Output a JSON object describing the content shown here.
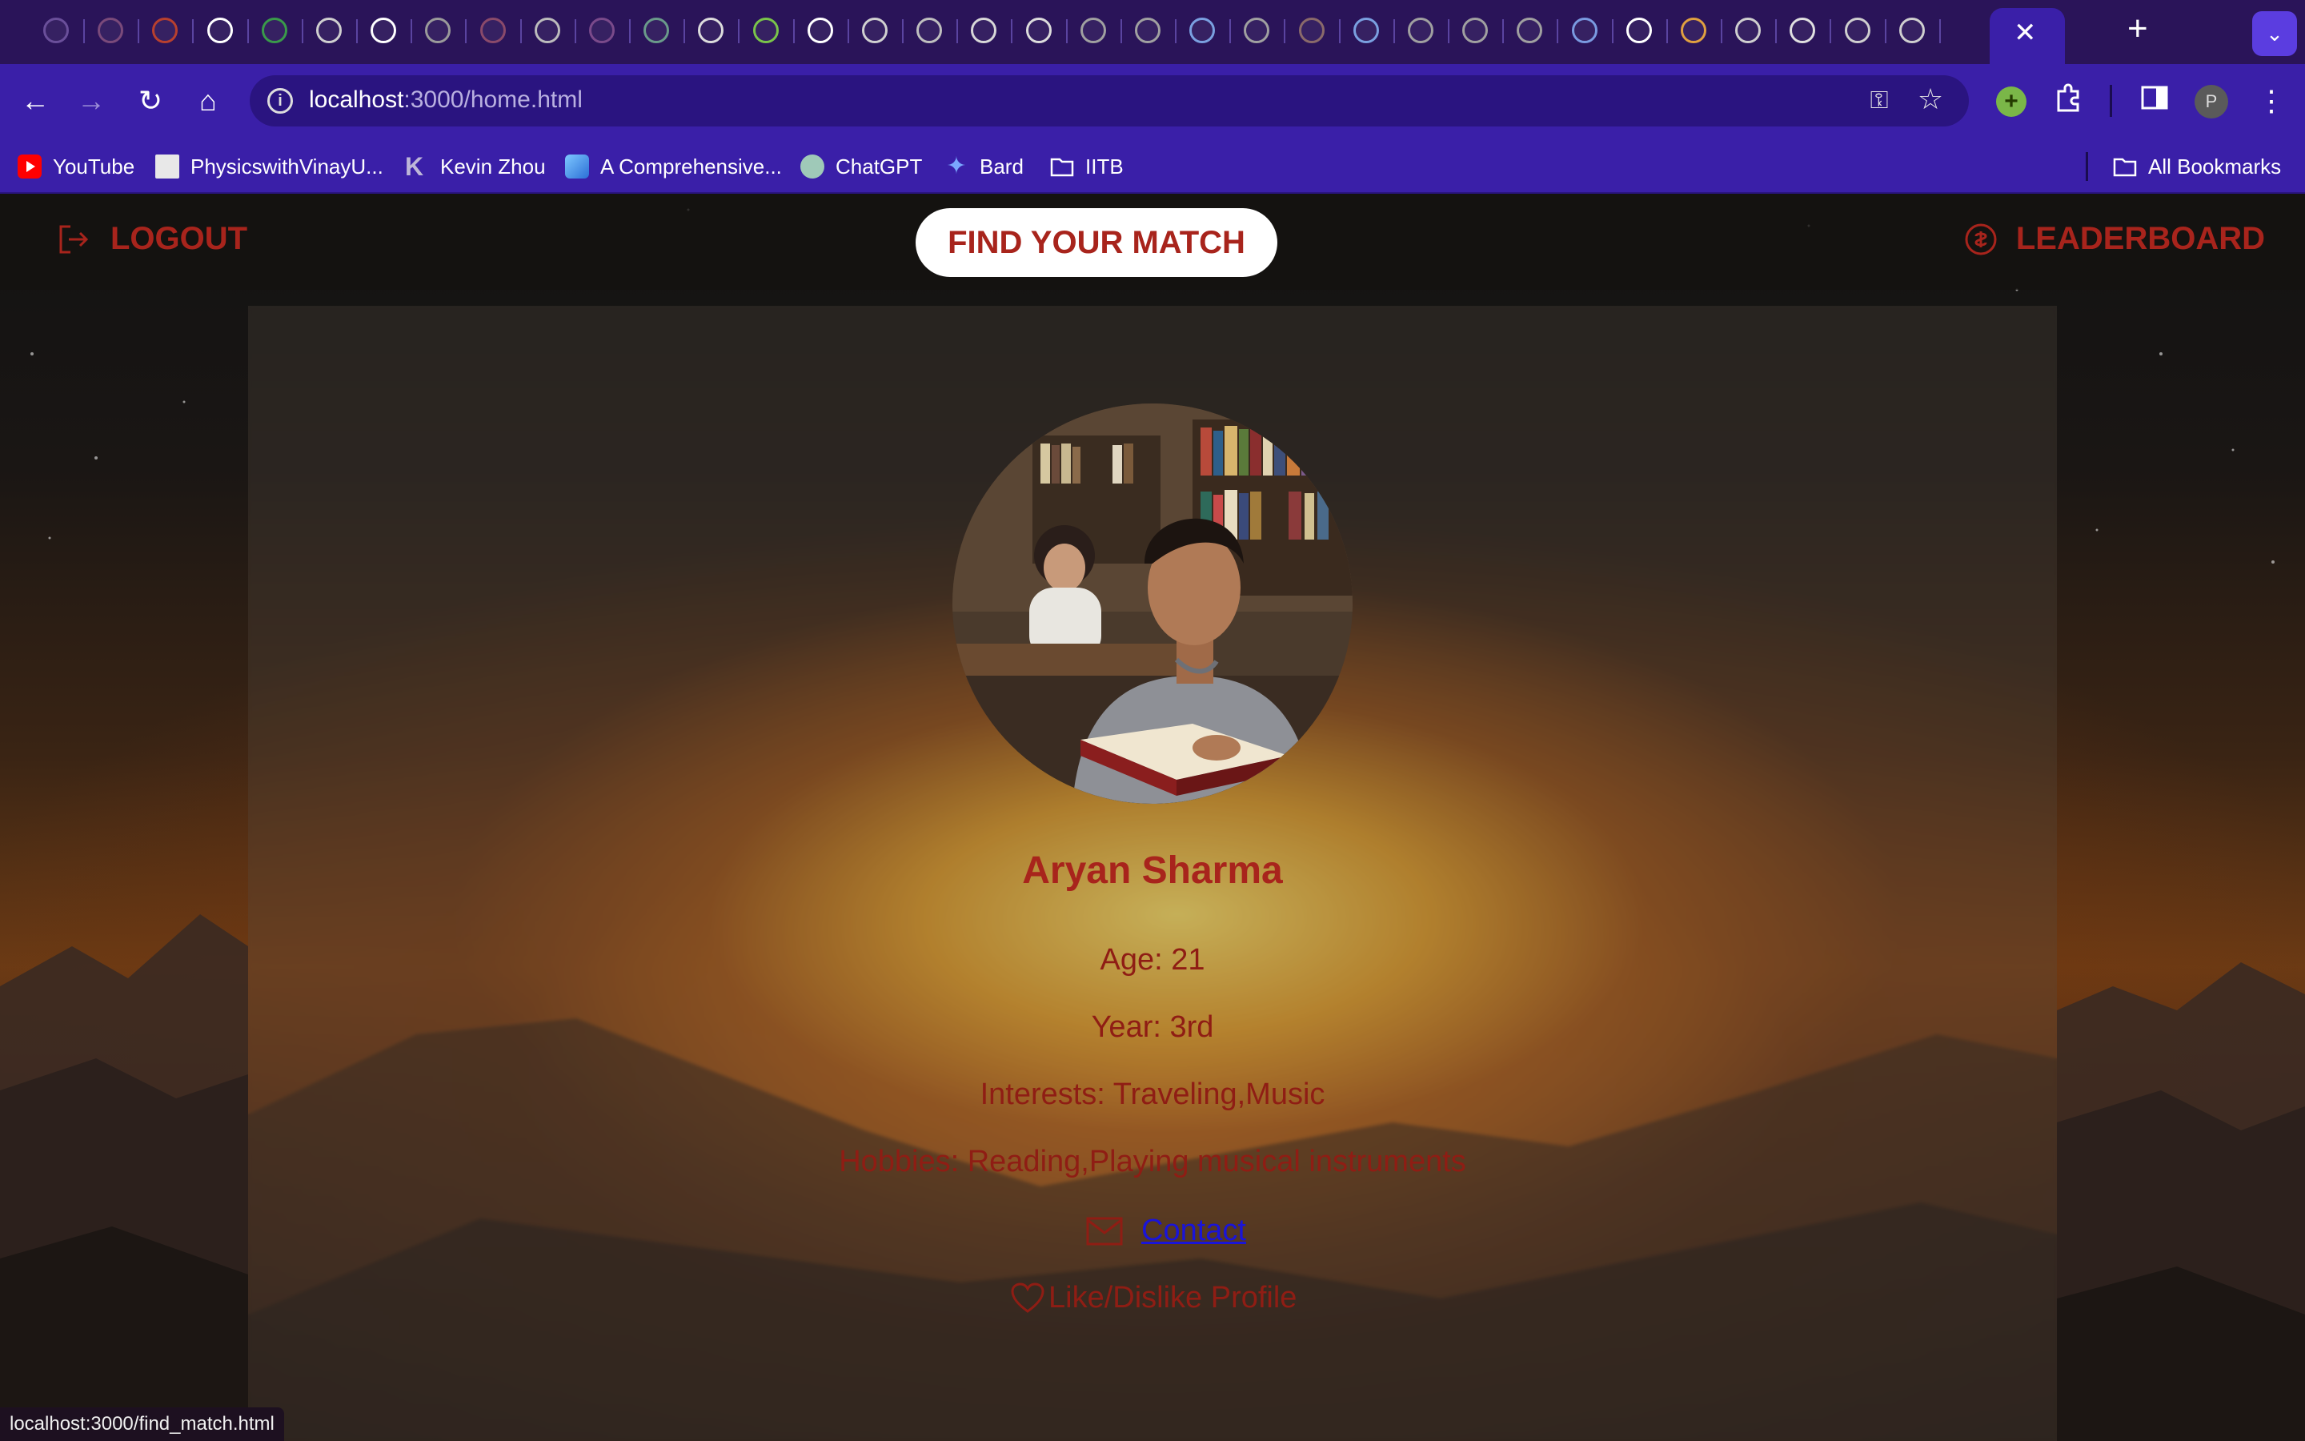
{
  "browser": {
    "tab_count_icons": 37,
    "url_host": "localhost",
    "url_path": ":3000/home.html",
    "profile_initial": "P",
    "status_url": "localhost:3000/find_match.html",
    "bookmarks": [
      {
        "label": "YouTube",
        "icon": "youtube-icon"
      },
      {
        "label": "PhysicswithVinayU...",
        "icon": "site-icon"
      },
      {
        "label": "Kevin Zhou",
        "icon": "k-icon"
      },
      {
        "label": "A Comprehensive...",
        "icon": "cube-icon"
      },
      {
        "label": "ChatGPT",
        "icon": "chatgpt-icon"
      },
      {
        "label": "Bard",
        "icon": "sparkle-icon"
      },
      {
        "label": "IITB",
        "icon": "folder-icon"
      }
    ],
    "all_bookmarks_label": "All Bookmarks"
  },
  "nav": {
    "logout_label": "LOGOUT",
    "find_match_label": "FIND YOUR MATCH",
    "leaderboard_label": "LEADERBOARD"
  },
  "profile": {
    "name": "Aryan Sharma",
    "age": "Age: 21",
    "year": "Year: 3rd",
    "interests": "Interests: Traveling,Music",
    "hobbies": "Hobbies: Reading,Playing musical instruments",
    "contact_label": "Contact",
    "like_label": "Like/Dislike Profile"
  },
  "colors": {
    "chrome_purple": "#3a1fa8",
    "tabstrip_purple": "#2a1459",
    "accent_red": "#a8241c",
    "link_blue": "#1a14d8"
  }
}
